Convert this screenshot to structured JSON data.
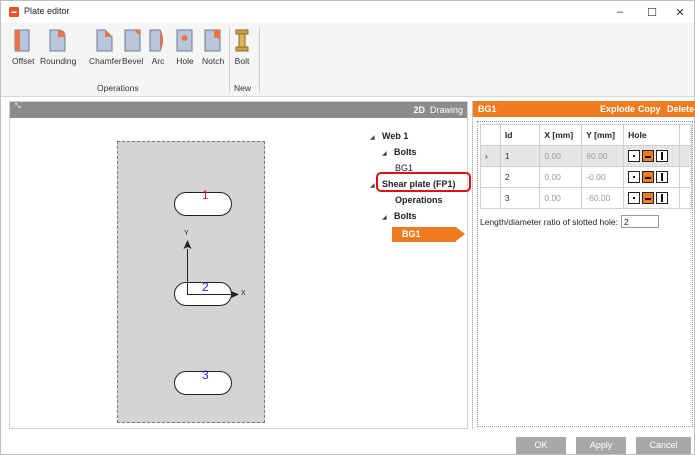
{
  "window": {
    "title": "Plate editor",
    "minimize": "–",
    "maximize": "☐",
    "close": "✕"
  },
  "ribbon": {
    "tools": [
      "Offset",
      "Rounding",
      "Chamfer",
      "Bevel",
      "Arc",
      "Hole",
      "Notch",
      "Bolt"
    ],
    "groups": {
      "operations": "Operations",
      "new": "New"
    }
  },
  "drawing": {
    "expand_icon": "⤡",
    "mode_2d": "2D",
    "mode_drawing": "Drawing",
    "holes": [
      "1",
      "2",
      "3"
    ],
    "axis_y": "Y",
    "axis_x": "X"
  },
  "tree": {
    "web": "Web 1",
    "web_bolts": "Bolts",
    "web_bg1": "BG1",
    "shear_plate": "Shear plate (FP1)",
    "operations": "Operations",
    "plate_bolts": "Bolts",
    "selected_bg1": "BG1"
  },
  "props": {
    "title": "BG1",
    "actions": {
      "explode": "Explode",
      "copy": "Copy",
      "delete": "Delete"
    },
    "columns": [
      "Id",
      "X [mm]",
      "Y [mm]",
      "Hole"
    ],
    "rows": [
      {
        "marker": "›",
        "id": "1",
        "x": "0.00",
        "y": "60.00"
      },
      {
        "marker": "",
        "id": "2",
        "x": "0.00",
        "y": "-0.00"
      },
      {
        "marker": "",
        "id": "3",
        "x": "0.00",
        "y": "-60.00"
      }
    ],
    "ratio_label": "Length/diameter ratio of slotted hole:",
    "ratio_value": "2"
  },
  "buttons": {
    "ok": "OK",
    "apply": "Apply",
    "cancel": "Cancel"
  },
  "colors": {
    "accent": "#f07c22",
    "highlight": "#e01010",
    "hole_number_red": "#e02020",
    "hole_number_blue": "#2020e0"
  }
}
